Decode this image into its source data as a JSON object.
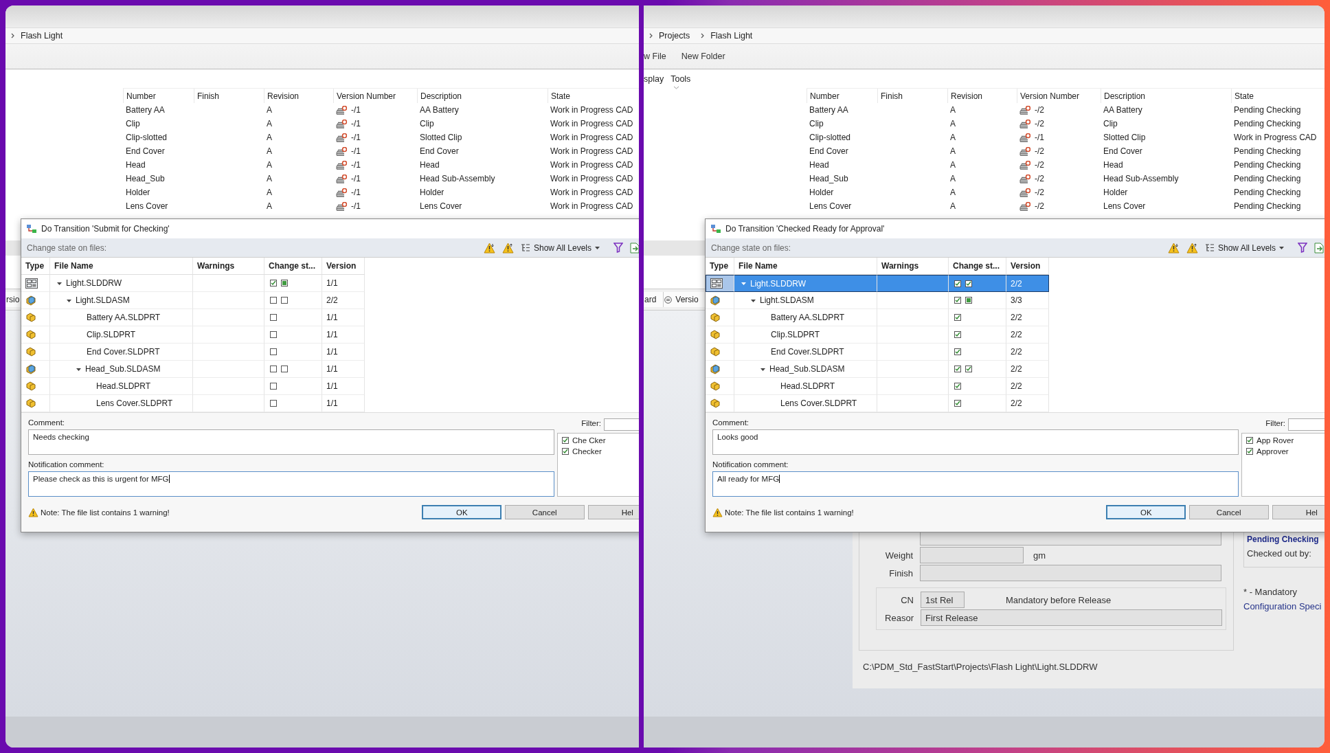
{
  "panels": [
    {
      "breadcrumb": [
        {
          "label": "Flash Light"
        }
      ],
      "list": {
        "columns": [
          "Number",
          "Finish",
          "Revision",
          "Version Number",
          "Description",
          "State"
        ],
        "rows": [
          {
            "number": "Battery AA",
            "revision": "A",
            "version": "-/1",
            "description": "AA Battery",
            "state": "Work in Progress CAD"
          },
          {
            "number": "Clip",
            "revision": "A",
            "version": "-/1",
            "description": "Clip",
            "state": "Work in Progress CAD"
          },
          {
            "number": "Clip-slotted",
            "revision": "A",
            "version": "-/1",
            "description": "Slotted Clip",
            "state": "Work in Progress CAD"
          },
          {
            "number": "End Cover",
            "revision": "A",
            "version": "-/1",
            "description": "End Cover",
            "state": "Work in Progress CAD"
          },
          {
            "number": "Head",
            "revision": "A",
            "version": "-/1",
            "description": "Head",
            "state": "Work in Progress CAD"
          },
          {
            "number": "Head_Sub",
            "revision": "A",
            "version": "-/1",
            "description": "Head Sub-Assembly",
            "state": "Work in Progress CAD"
          },
          {
            "number": "Holder",
            "revision": "A",
            "version": "-/1",
            "description": "Holder",
            "state": "Work in Progress CAD"
          },
          {
            "number": "Lens Cover",
            "revision": "A",
            "version": "-/1",
            "description": "Lens Cover",
            "state": "Work in Progress CAD"
          }
        ]
      },
      "tabs": [
        {
          "label": "rsio"
        }
      ],
      "dialog": {
        "title": "Do Transition 'Submit for Checking'",
        "subtitle": "Change state on files:",
        "levels": "Show All Levels",
        "columns": [
          "Type",
          "File Name",
          "Warnings",
          "Change st...",
          "Version"
        ],
        "files": [
          {
            "kind": "drawing",
            "name": "Light.SLDDRW",
            "expanded": true,
            "selected": false,
            "checks": [
              {
                "kind": "box",
                "checked": true
              },
              {
                "kind": "square",
                "checked": true
              }
            ],
            "version": "1/1",
            "children": [
              {
                "kind": "assembly",
                "name": "Light.SLDASM",
                "expanded": true,
                "selected": false,
                "checks": [
                  {
                    "kind": "box",
                    "checked": false
                  },
                  {
                    "kind": "square",
                    "checked": false
                  }
                ],
                "version": "2/2",
                "children": [
                  {
                    "kind": "part",
                    "name": "Battery AA.SLDPRT",
                    "selected": false,
                    "checks": [
                      {
                        "kind": "box",
                        "checked": false
                      }
                    ],
                    "version": "1/1"
                  },
                  {
                    "kind": "part",
                    "name": "Clip.SLDPRT",
                    "selected": false,
                    "checks": [
                      {
                        "kind": "box",
                        "checked": false
                      }
                    ],
                    "version": "1/1"
                  },
                  {
                    "kind": "part",
                    "name": "End Cover.SLDPRT",
                    "selected": false,
                    "checks": [
                      {
                        "kind": "box",
                        "checked": false
                      }
                    ],
                    "version": "1/1"
                  },
                  {
                    "kind": "assembly",
                    "name": "Head_Sub.SLDASM",
                    "expanded": true,
                    "selected": false,
                    "checks": [
                      {
                        "kind": "box",
                        "checked": false
                      },
                      {
                        "kind": "box",
                        "checked": false
                      }
                    ],
                    "version": "1/1",
                    "children": [
                      {
                        "kind": "part",
                        "name": "Head.SLDPRT",
                        "selected": false,
                        "checks": [
                          {
                            "kind": "box",
                            "checked": false
                          }
                        ],
                        "version": "1/1"
                      },
                      {
                        "kind": "part",
                        "name": "Lens Cover.SLDPRT",
                        "selected": false,
                        "checks": [
                          {
                            "kind": "box",
                            "checked": false
                          }
                        ],
                        "version": "1/1"
                      }
                    ]
                  }
                ]
              }
            ]
          }
        ],
        "comment_label": "Comment:",
        "comment": "Needs checking",
        "notification_label": "Notification comment:",
        "notification": "Please check as this is urgent for MFG",
        "filter_label": "Filter:",
        "recipients": [
          {
            "label": "Che Cker",
            "checked": true
          },
          {
            "label": "Checker",
            "checked": true
          }
        ],
        "note": "Note: The file list contains 1 warning!",
        "buttons": [
          {
            "label": "OK",
            "default": true
          },
          {
            "label": "Cancel",
            "default": false
          },
          {
            "label": "Hel",
            "default": false
          }
        ]
      }
    },
    {
      "breadcrumb": [
        {
          "label": "Projects"
        },
        {
          "label": "Flash Light"
        }
      ],
      "toolbar": [
        {
          "label": "w File"
        },
        {
          "label": "New Folder"
        }
      ],
      "menu": [
        {
          "label": "splay"
        },
        {
          "label": "Tools"
        }
      ],
      "list": {
        "columns": [
          "Number",
          "Finish",
          "Revision",
          "Version Number",
          "Description",
          "State"
        ],
        "rows": [
          {
            "number": "Battery AA",
            "revision": "A",
            "version": "-/2",
            "description": "AA Battery",
            "state": "Pending Checking"
          },
          {
            "number": "Clip",
            "revision": "A",
            "version": "-/2",
            "description": "Clip",
            "state": "Pending Checking"
          },
          {
            "number": "Clip-slotted",
            "revision": "A",
            "version": "-/1",
            "description": "Slotted Clip",
            "state": "Work in Progress CAD"
          },
          {
            "number": "End Cover",
            "revision": "A",
            "version": "-/2",
            "description": "End Cover",
            "state": "Pending Checking"
          },
          {
            "number": "Head",
            "revision": "A",
            "version": "-/2",
            "description": "Head",
            "state": "Pending Checking"
          },
          {
            "number": "Head_Sub",
            "revision": "A",
            "version": "-/2",
            "description": "Head Sub-Assembly",
            "state": "Pending Checking"
          },
          {
            "number": "Holder",
            "revision": "A",
            "version": "-/2",
            "description": "Holder",
            "state": "Pending Checking"
          },
          {
            "number": "Lens Cover",
            "revision": "A",
            "version": "-/2",
            "description": "Lens Cover",
            "state": "Pending Checking"
          }
        ]
      },
      "tabs": [
        {
          "label": "ard"
        },
        {
          "label": "Versio"
        }
      ],
      "details": {
        "rows": [
          {
            "label": "Weight",
            "unit": "gm"
          },
          {
            "label": "Finish"
          }
        ],
        "group": [
          {
            "label": "CN",
            "value": "1st Rel",
            "note": "Mandatory before Release"
          },
          {
            "label": "Reasor",
            "value": "First Release"
          }
        ],
        "path": "C:\\PDM_Std_FastStart\\Projects\\Flash Light\\Light.SLDDRW",
        "state": "Pending Checking",
        "checked_out_label": "Checked out by:",
        "mandatory": "* - Mandatory",
        "config_link": "Configuration Speci"
      },
      "dialog": {
        "title": "Do Transition 'Checked Ready for Approval'",
        "subtitle": "Change state on files:",
        "levels": "Show All Levels",
        "columns": [
          "Type",
          "File Name",
          "Warnings",
          "Change st...",
          "Version"
        ],
        "files": [
          {
            "kind": "drawing",
            "name": "Light.SLDDRW",
            "expanded": true,
            "selected": true,
            "checks": [
              {
                "kind": "box",
                "checked": true
              },
              {
                "kind": "box",
                "checked": true
              }
            ],
            "version": "2/2",
            "children": [
              {
                "kind": "assembly",
                "name": "Light.SLDASM",
                "expanded": true,
                "selected": false,
                "checks": [
                  {
                    "kind": "box",
                    "checked": true
                  },
                  {
                    "kind": "square",
                    "checked": true
                  }
                ],
                "version": "3/3",
                "children": [
                  {
                    "kind": "part",
                    "name": "Battery AA.SLDPRT",
                    "selected": false,
                    "checks": [
                      {
                        "kind": "box",
                        "checked": true
                      }
                    ],
                    "version": "2/2"
                  },
                  {
                    "kind": "part",
                    "name": "Clip.SLDPRT",
                    "selected": false,
                    "checks": [
                      {
                        "kind": "box",
                        "checked": true
                      }
                    ],
                    "version": "2/2"
                  },
                  {
                    "kind": "part",
                    "name": "End Cover.SLDPRT",
                    "selected": false,
                    "checks": [
                      {
                        "kind": "box",
                        "checked": true
                      }
                    ],
                    "version": "2/2"
                  },
                  {
                    "kind": "assembly",
                    "name": "Head_Sub.SLDASM",
                    "expanded": true,
                    "selected": false,
                    "checks": [
                      {
                        "kind": "box",
                        "checked": true
                      },
                      {
                        "kind": "box",
                        "checked": true
                      }
                    ],
                    "version": "2/2",
                    "children": [
                      {
                        "kind": "part",
                        "name": "Head.SLDPRT",
                        "selected": false,
                        "checks": [
                          {
                            "kind": "box",
                            "checked": true
                          }
                        ],
                        "version": "2/2"
                      },
                      {
                        "kind": "part",
                        "name": "Lens Cover.SLDPRT",
                        "selected": false,
                        "checks": [
                          {
                            "kind": "box",
                            "checked": true
                          }
                        ],
                        "version": "2/2"
                      }
                    ]
                  }
                ]
              }
            ]
          }
        ],
        "comment_label": "Comment:",
        "comment": "Looks good",
        "notification_label": "Notification comment:",
        "notification": "All ready for MFG",
        "filter_label": "Filter:",
        "recipients": [
          {
            "label": "App Rover",
            "checked": true
          },
          {
            "label": "Approver",
            "checked": true
          }
        ],
        "note": "Note: The file list contains 1 warning!",
        "buttons": [
          {
            "label": "OK",
            "default": true
          },
          {
            "label": "Cancel",
            "default": false
          },
          {
            "label": "Hel",
            "default": false
          }
        ]
      }
    }
  ]
}
